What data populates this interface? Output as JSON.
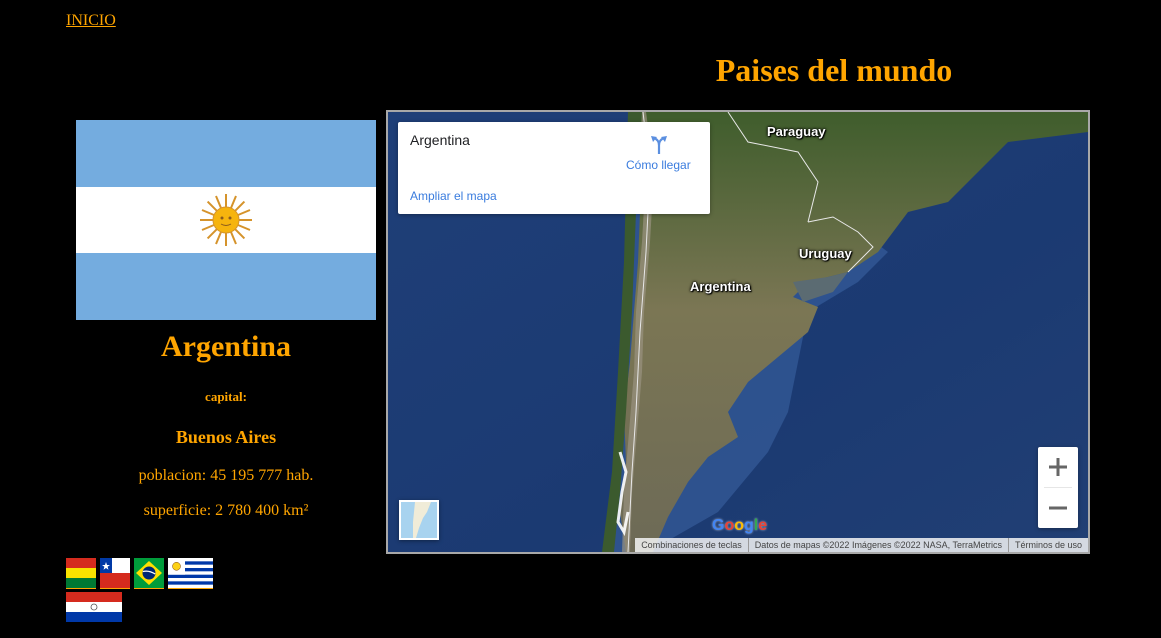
{
  "nav": {
    "home_label": "INICIO"
  },
  "page": {
    "title": "Paises del mundo"
  },
  "country": {
    "name": "Argentina",
    "capital_label": "capital:",
    "capital": "Buenos Aires",
    "population": "poblacion: 45 195 777 hab.",
    "area": "superficie: 2 780 400 km²"
  },
  "neighbor_flags": [
    "bolivia-flag",
    "chile-flag",
    "brazil-flag",
    "uruguay-flag",
    "paraguay-flag"
  ],
  "map": {
    "card_title": "Argentina",
    "directions_label": "Cómo llegar",
    "enlarge_label": "Ampliar el mapa",
    "labels": {
      "paraguay": "Paraguay",
      "uruguay": "Uruguay",
      "argentina": "Argentina"
    },
    "google_logo": "Google",
    "attribution": {
      "shortcuts": "Combinaciones de teclas",
      "data": "Datos de mapas ©2022 Imágenes ©2022 NASA, TerraMetrics",
      "terms": "Términos de uso"
    }
  },
  "colors": {
    "accent": "#ffa500",
    "background": "#000000",
    "link_blue": "#3a7cde"
  }
}
